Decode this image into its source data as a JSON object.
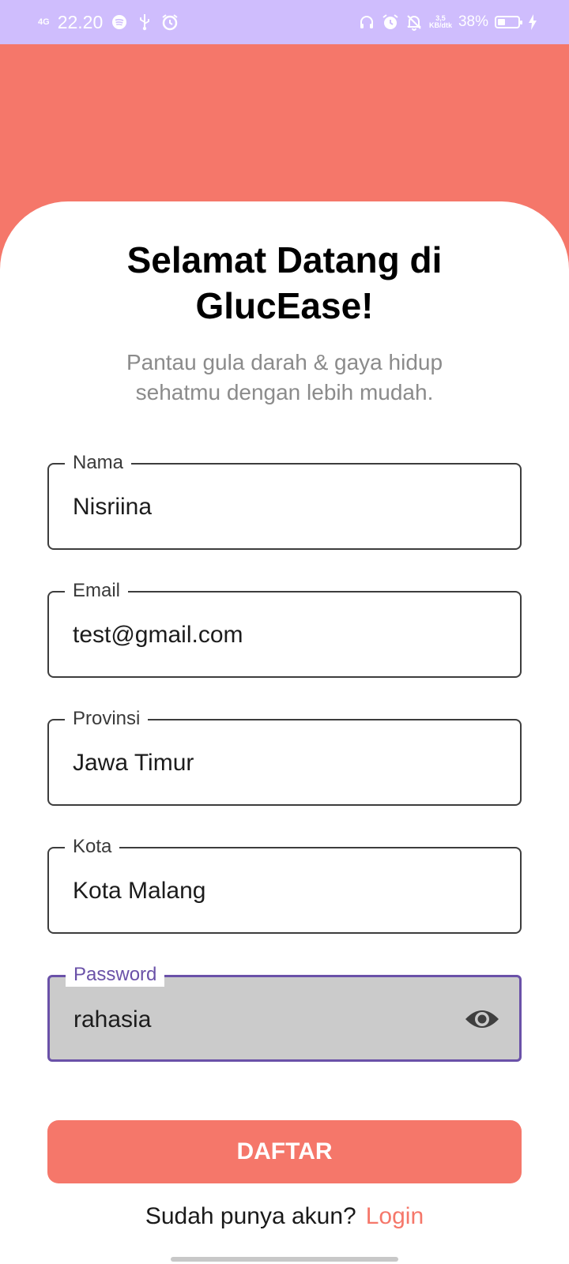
{
  "status_bar": {
    "network": "4G",
    "time": "22.20",
    "speed_value": "3,5",
    "speed_unit": "KB/dtk",
    "battery_text": "38%",
    "battery_level": 0.38,
    "icons_left": [
      "spotify-icon",
      "usb-icon",
      "alarm-icon"
    ],
    "icons_right": [
      "headphones-icon",
      "alarm-icon",
      "bell-off-icon",
      "battery-icon",
      "charging-icon"
    ]
  },
  "header": {
    "title": "Selamat Datang di GlucEase!",
    "subtitle": "Pantau gula darah & gaya hidup sehatmu dengan lebih mudah."
  },
  "form": {
    "name": {
      "label": "Nama",
      "value": "Nisriina"
    },
    "email": {
      "label": "Email",
      "value": "test@gmail.com"
    },
    "province": {
      "label": "Provinsi",
      "value": "Jawa Timur"
    },
    "city": {
      "label": "Kota",
      "value": "Kota Malang"
    },
    "password": {
      "label": "Password",
      "value": "rahasia",
      "icon": "eye-icon"
    }
  },
  "actions": {
    "register_label": "DAFTAR",
    "login_prompt": "Sudah punya akun?",
    "login_link": "Login"
  },
  "colors": {
    "accent": "#f5776a",
    "status_bar": "#cfbdfd",
    "focus": "#6a51a8"
  }
}
